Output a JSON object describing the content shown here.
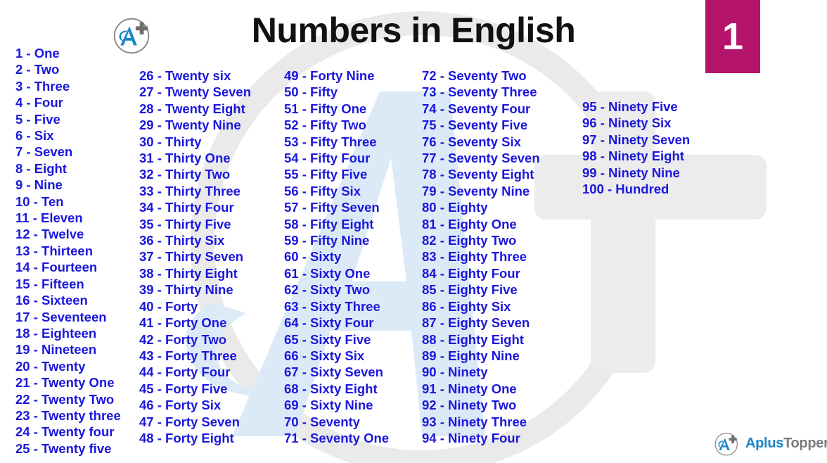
{
  "header": {
    "title": "Numbers in English",
    "logo_icon": "aplustopper-circle-a-plus-icon",
    "badge_number": "1"
  },
  "footer": {
    "brand_icon": "aplustopper-circle-a-plus-icon",
    "brand_primary": "Aplus",
    "brand_secondary": "Topper"
  },
  "colors": {
    "number_text": "#1a17dd",
    "title_text": "#111111",
    "badge_background": "#b5146b",
    "badge_text": "#ffffff",
    "logo_blue": "#1b86c9",
    "logo_gray": "#7b7b7b",
    "watermark_gray": "#eaeaea",
    "watermark_blue": "#dbe9f7",
    "page_background": "#ffffff"
  },
  "columns": [
    {
      "name": "column-1",
      "items": [
        "1 - One",
        "2 - Two",
        "3 - Three",
        "4 - Four",
        "5 - Five",
        "6 - Six",
        "7 - Seven",
        "8 - Eight",
        "9 - Nine",
        "10 - Ten",
        "11 - Eleven",
        "12 - Twelve",
        "13 - Thirteen",
        "14 - Fourteen",
        "15 - Fifteen",
        "16 - Sixteen",
        "17 - Seventeen",
        "18 - Eighteen",
        "19 - Nineteen",
        "20 - Twenty",
        "21 - Twenty One",
        "22 - Twenty Two",
        "23 - Twenty three",
        "24 - Twenty four",
        "25 - Twenty five"
      ]
    },
    {
      "name": "column-2",
      "items": [
        "26 - Twenty six",
        "27 - Twenty Seven",
        "28 - Twenty Eight",
        "29 - Twenty Nine",
        "30 - Thirty",
        "31 - Thirty One",
        "32 - Thirty Two",
        "33 - Thirty Three",
        "34 - Thirty Four",
        "35 - Thirty Five",
        "36 - Thirty Six",
        "37 - Thirty Seven",
        "38 - Thirty Eight",
        "39 - Thirty Nine",
        "40 - Forty",
        "41 - Forty One",
        "42 - Forty Two",
        "43 - Forty Three",
        "44 - Forty Four",
        "45 - Forty Five",
        "46 - Forty Six",
        "47 - Forty Seven",
        "48 - Forty Eight"
      ]
    },
    {
      "name": "column-3",
      "items": [
        "49 - Forty Nine",
        "50 - Fifty",
        "51 - Fifty One",
        "52 - Fifty Two",
        "53 - Fifty Three",
        "54 - Fifty Four",
        "55 - Fifty Five",
        "56 - Fifty Six",
        "57 - Fifty Seven",
        "58 - Fifty Eight",
        "59 - Fifty Nine",
        "60 - Sixty",
        "61 - Sixty One",
        "62 - Sixty Two",
        "63 - Sixty Three",
        "64 - Sixty Four",
        "65 - Sixty Five",
        "66 - Sixty Six",
        "67 - Sixty Seven",
        "68 - Sixty Eight",
        "69 - Sixty Nine",
        "70 - Seventy",
        "71 - Seventy One"
      ]
    },
    {
      "name": "column-4",
      "items": [
        "72 - Seventy Two",
        "73 - Seventy Three",
        "74 - Seventy Four",
        "75 - Seventy Five",
        "76 - Seventy Six",
        "77 - Seventy Seven",
        "78 - Seventy Eight",
        "79 - Seventy Nine",
        "80 - Eighty",
        "81 - Eighty One",
        "82 - Eighty Two",
        "83 - Eighty Three",
        "84 - Eighty Four",
        "85 - Eighty Five",
        "86 - Eighty Six",
        "87 - Eighty Seven",
        "88 - Eighty Eight",
        "89 - Eighty Nine",
        "90 - Ninety",
        "91 - Ninety One",
        "92 - Ninety Two",
        "93 - Ninety Three",
        "94 - Ninety Four"
      ]
    },
    {
      "name": "column-5",
      "items": [
        "95 - Ninety Five",
        "96 - Ninety Six",
        "97 - Ninety Seven",
        "98 - Ninety Eight",
        "99 - Ninety Nine",
        "100 - Hundred"
      ]
    }
  ]
}
